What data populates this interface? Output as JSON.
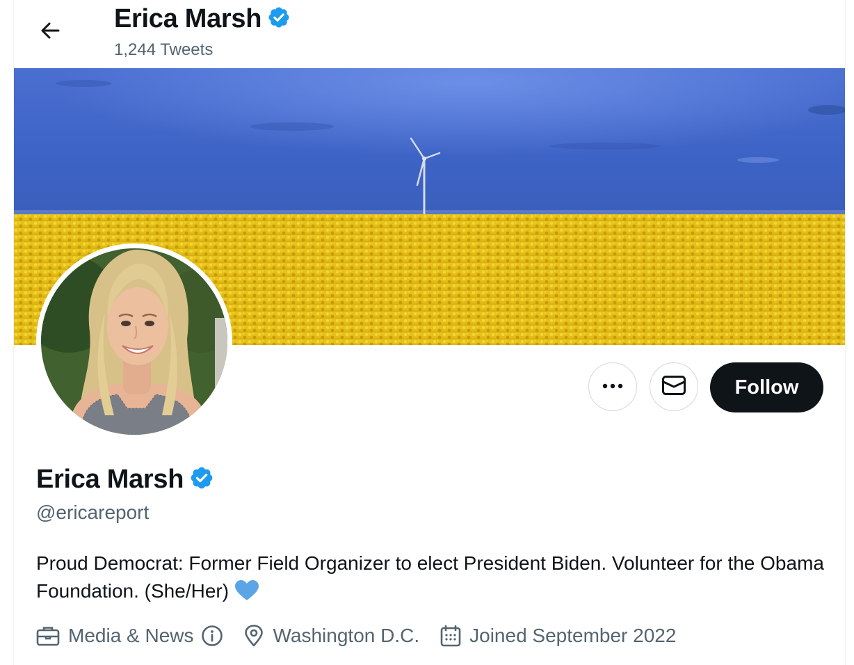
{
  "header": {
    "name": "Erica Marsh",
    "tweet_count": "1,244 Tweets",
    "verified": true
  },
  "profile": {
    "name": "Erica Marsh",
    "handle": "@ericareport",
    "verified": true,
    "bio": "Proud Democrat: Former Field Organizer to elect President Biden. Volunteer for the Obama Foundation. (She/Her)",
    "category": "Media & News",
    "location": "Washington D.C.",
    "joined": "Joined September 2022"
  },
  "actions": {
    "follow_label": "Follow",
    "more_icon": "more-icon",
    "message_icon": "envelope-icon"
  },
  "colors": {
    "verified_badge": "#1d9bf0",
    "follow_bg": "#0f1419",
    "secondary_text": "#536471",
    "heart": "#5ba4e6",
    "banner_sky": "#3d65c9",
    "banner_field": "#e8c31a"
  }
}
